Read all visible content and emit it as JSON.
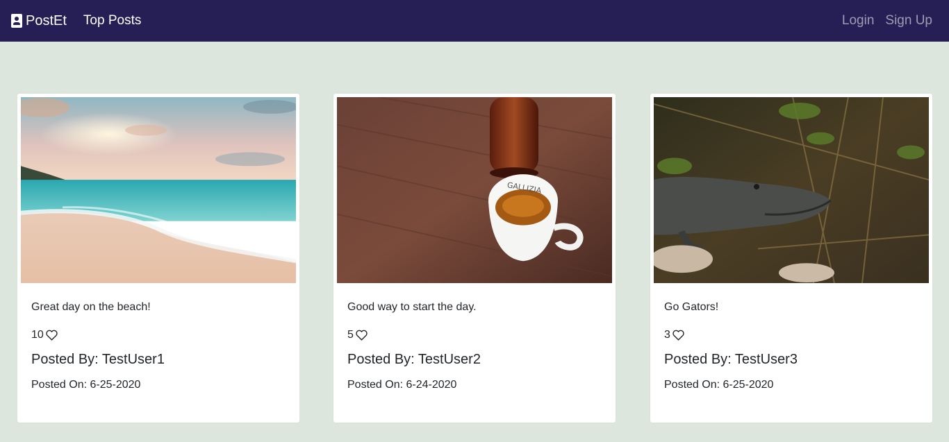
{
  "nav": {
    "brand": "PostEt",
    "top_posts": "Top Posts",
    "login": "Login",
    "signup": "Sign Up"
  },
  "posts": [
    {
      "caption": "Great day on the beach!",
      "likes": "10",
      "posted_by": "Posted By: TestUser1",
      "posted_on": "Posted On: 6-25-2020"
    },
    {
      "caption": "Good way to start the day.",
      "likes": "5",
      "posted_by": "Posted By: TestUser2",
      "posted_on": "Posted On: 6-24-2020"
    },
    {
      "caption": "Go Gators!",
      "likes": "3",
      "posted_by": "Posted By: TestUser3",
      "posted_on": "Posted On: 6-25-2020"
    }
  ],
  "colors": {
    "navbar": "#261f56",
    "background": "#dce6dc",
    "card": "#ffffff"
  }
}
